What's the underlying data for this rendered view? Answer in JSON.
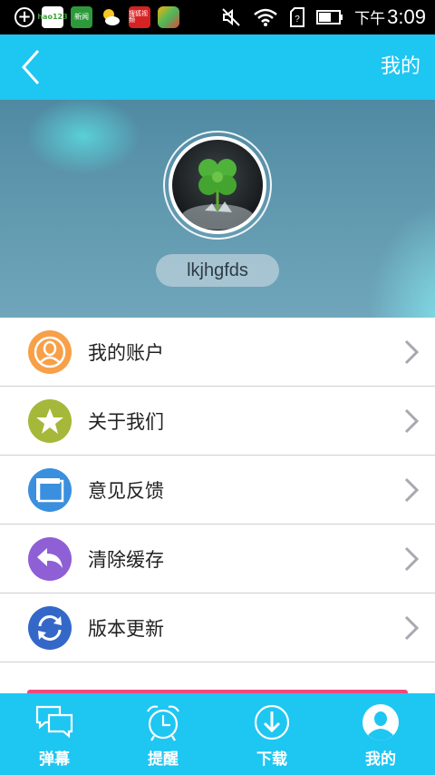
{
  "status_bar": {
    "icons": [
      {
        "name": "add-icon",
        "text": "+"
      },
      {
        "name": "hao123-icon",
        "text": "hao123"
      },
      {
        "name": "news-icon",
        "text": "新闻"
      },
      {
        "name": "weather-icon",
        "text": ""
      },
      {
        "name": "sohu-video-icon",
        "text": "搜狐视频"
      },
      {
        "name": "app-store-icon",
        "text": ""
      }
    ],
    "time_prefix": "下午",
    "time": "3:09",
    "battery_level": 0.6
  },
  "header": {
    "title": "我的",
    "back_icon": "chevron-left-icon"
  },
  "profile": {
    "username": "lkjhgfds",
    "avatar": "clover-avatar"
  },
  "menu": {
    "items": [
      {
        "label": "我的账户",
        "icon": "user-icon",
        "color": "#f7a048"
      },
      {
        "label": "关于我们",
        "icon": "star-icon",
        "color": "#a5b83a"
      },
      {
        "label": "意见反馈",
        "icon": "window-icon",
        "color": "#3a8fde"
      },
      {
        "label": "清除缓存",
        "icon": "undo-icon",
        "color": "#8f5fd6"
      },
      {
        "label": "版本更新",
        "icon": "refresh-icon",
        "color": "#3468c8"
      }
    ]
  },
  "bottom_nav": {
    "items": [
      {
        "label": "弹幕",
        "icon": "chat-icon",
        "active": false
      },
      {
        "label": "提醒",
        "icon": "alarm-clock-icon",
        "active": false
      },
      {
        "label": "下载",
        "icon": "download-icon",
        "active": false
      },
      {
        "label": "我的",
        "icon": "user-icon",
        "active": true
      }
    ]
  },
  "colors": {
    "accent": "#1ec6f2",
    "pink": "#ee4a7c"
  }
}
